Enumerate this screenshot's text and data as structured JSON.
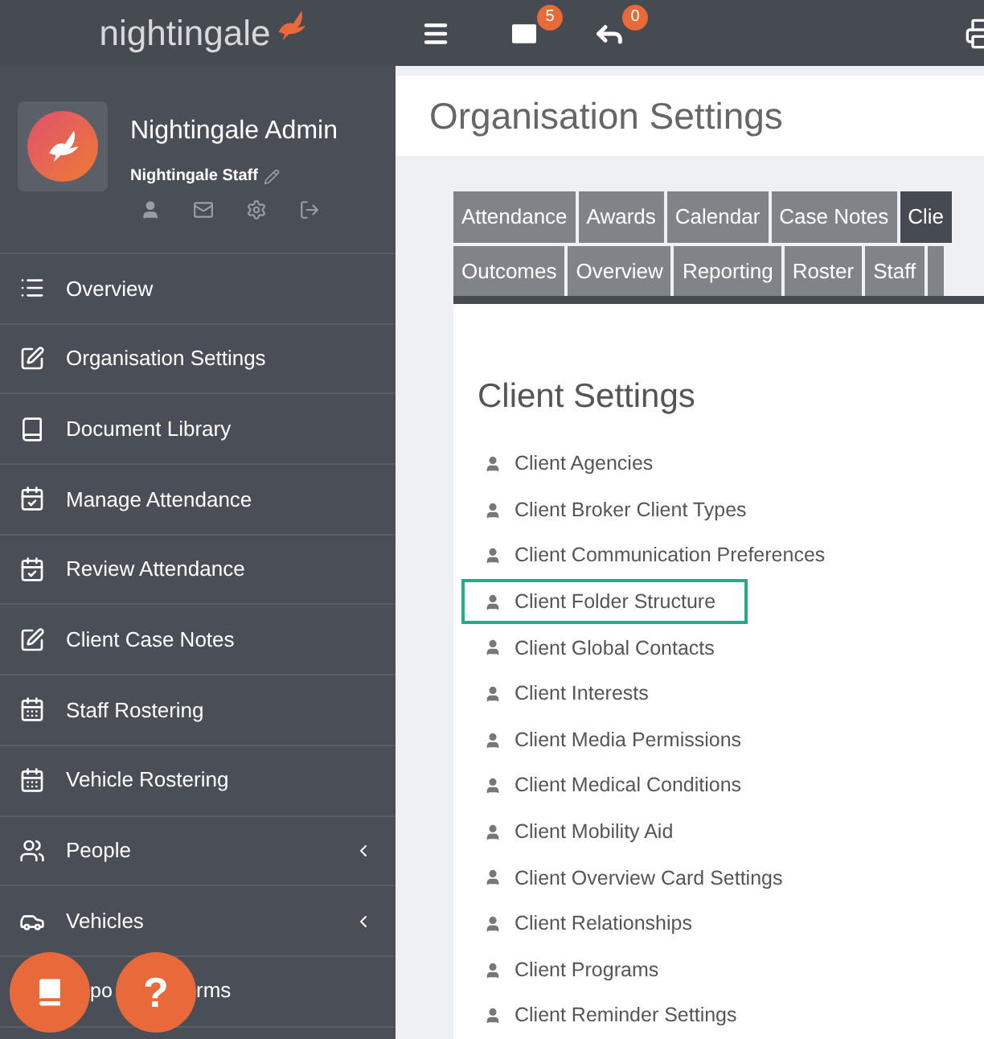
{
  "topbar": {
    "logo_text": "nightingale",
    "mail_badge": "5",
    "reply_badge": "0"
  },
  "profile": {
    "name": "Nightingale Admin",
    "role": "Nightingale Staff"
  },
  "sidebar": {
    "items": [
      {
        "label": "Overview",
        "expandable": false
      },
      {
        "label": "Organisation Settings",
        "expandable": false
      },
      {
        "label": "Document Library",
        "expandable": false
      },
      {
        "label": "Manage Attendance",
        "expandable": false
      },
      {
        "label": "Review Attendance",
        "expandable": false
      },
      {
        "label": "Client Case Notes",
        "expandable": false
      },
      {
        "label": "Staff Rostering",
        "expandable": false
      },
      {
        "label": "Vehicle Rostering",
        "expandable": false
      },
      {
        "label": "People",
        "expandable": true
      },
      {
        "label": "Vehicles",
        "expandable": true
      }
    ],
    "partial_item": {
      "visible_parts": [
        "po",
        "rms"
      ]
    }
  },
  "page": {
    "title": "Organisation Settings"
  },
  "tabs": [
    [
      {
        "label": "Attendance",
        "selected": false
      },
      {
        "label": "Awards",
        "selected": false
      },
      {
        "label": "Calendar",
        "selected": false
      },
      {
        "label": "Case Notes",
        "selected": false
      },
      {
        "label": "Clie",
        "selected": true
      }
    ],
    [
      {
        "label": "Outcomes",
        "selected": false
      },
      {
        "label": "Overview",
        "selected": false
      },
      {
        "label": "Reporting",
        "selected": false
      },
      {
        "label": "Roster",
        "selected": false
      },
      {
        "label": "Staff",
        "selected": false
      }
    ]
  ],
  "section": {
    "title": "Client Settings",
    "items": [
      {
        "label": "Client Agencies",
        "selected": false
      },
      {
        "label": "Client Broker Client Types",
        "selected": false
      },
      {
        "label": "Client Communication Preferences",
        "selected": false
      },
      {
        "label": "Client Folder Structure",
        "selected": true
      },
      {
        "label": "Client Global Contacts",
        "selected": false
      },
      {
        "label": "Client Interests",
        "selected": false
      },
      {
        "label": "Client Media Permissions",
        "selected": false
      },
      {
        "label": "Client Medical Conditions",
        "selected": false
      },
      {
        "label": "Client Mobility Aid",
        "selected": false
      },
      {
        "label": "Client Overview Card Settings",
        "selected": false
      },
      {
        "label": "Client Relationships",
        "selected": false
      },
      {
        "label": "Client Programs",
        "selected": false
      },
      {
        "label": "Client Reminder Settings",
        "selected": false
      }
    ]
  },
  "help_button": {
    "label": "?"
  }
}
